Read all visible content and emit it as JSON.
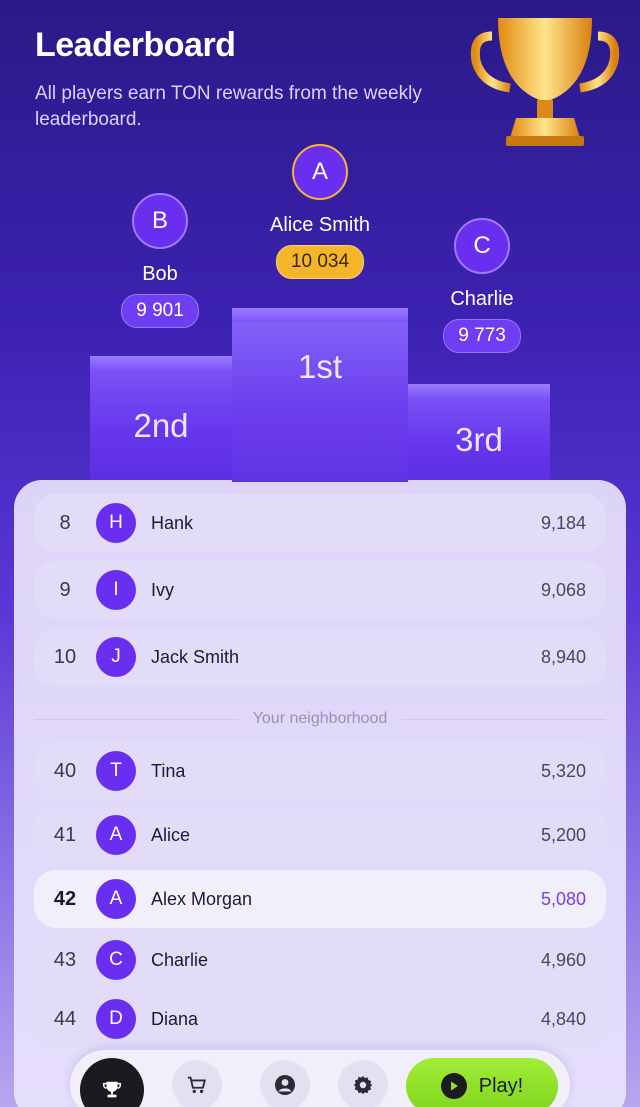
{
  "header": {
    "title": "Leaderboard",
    "subtitle": "All players earn TON rewards from the weekly leaderboard."
  },
  "podium": {
    "first": {
      "initial": "A",
      "name": "Alice Smith",
      "score": "10 034",
      "label": "1st"
    },
    "second": {
      "initial": "B",
      "name": "Bob",
      "score": "9 901",
      "label": "2nd"
    },
    "third": {
      "initial": "C",
      "name": "Charlie",
      "score": "9 773",
      "label": "3rd"
    }
  },
  "top_list": [
    {
      "rank": "8",
      "initial": "H",
      "name": "Hank",
      "score": "9,184"
    },
    {
      "rank": "9",
      "initial": "I",
      "name": "Ivy",
      "score": "9,068"
    },
    {
      "rank": "10",
      "initial": "J",
      "name": "Jack Smith",
      "score": "8,940"
    }
  ],
  "neighborhood_label": "Your neighborhood",
  "neighborhood": [
    {
      "rank": "40",
      "initial": "T",
      "name": "Tina",
      "score": "5,320"
    },
    {
      "rank": "41",
      "initial": "A",
      "name": "Alice",
      "score": "5,200"
    },
    {
      "rank": "42",
      "initial": "A",
      "name": "Alex Morgan",
      "score": "5,080"
    },
    {
      "rank": "43",
      "initial": "C",
      "name": "Charlie",
      "score": "4,960"
    },
    {
      "rank": "44",
      "initial": "D",
      "name": "Diana",
      "score": "4,840"
    }
  ],
  "nav": {
    "items": [
      "trophy-icon",
      "cart-icon",
      "profile-icon",
      "gear-icon"
    ],
    "play_label": "Play!"
  },
  "colors": {
    "accent": "#6a2ef0",
    "gold": "#f5b52a",
    "play": "#8fe12a"
  }
}
